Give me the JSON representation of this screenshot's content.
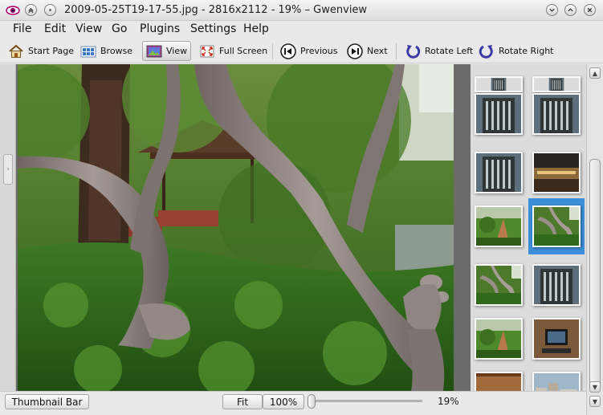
{
  "window": {
    "title": "2009-05-25T19-17-55.jpg - 2816x2112 - 19% – Gwenview"
  },
  "menu": [
    "File",
    "Edit",
    "View",
    "Go",
    "Plugins",
    "Settings",
    "Help"
  ],
  "toolbar": {
    "start_page": "Start Page",
    "browse": "Browse",
    "view": "View",
    "full_screen": "Full Screen",
    "previous": "Previous",
    "next": "Next",
    "rotate_left": "Rotate Left",
    "rotate_right": "Rotate Right",
    "active_mode": "View"
  },
  "bottom": {
    "thumbnail_bar": "Thumbnail Bar",
    "fit": "Fit",
    "zoom_100": "100%",
    "zoom_value": "19%",
    "zoom_level": 19
  },
  "thumbnails": {
    "selected_index": 5,
    "items": [
      {
        "icon": "building-thumbnail"
      },
      {
        "icon": "building-thumbnail"
      },
      {
        "icon": "building-thumbnail"
      },
      {
        "icon": "restaurant-thumbnail"
      },
      {
        "icon": "garden-thumbnail"
      },
      {
        "icon": "tree-thumbnail"
      },
      {
        "icon": "tree-thumbnail"
      },
      {
        "icon": "building-thumbnail"
      },
      {
        "icon": "garden-thumbnail"
      },
      {
        "icon": "screen-thumbnail"
      },
      {
        "icon": "wall-thumbnail"
      },
      {
        "icon": "city-thumbnail"
      },
      {
        "icon": "people-thumbnail"
      }
    ]
  },
  "colors": {
    "selection": "#3c8ed8",
    "foliage": "#3f7a22",
    "bark": "#8a7f7d"
  }
}
